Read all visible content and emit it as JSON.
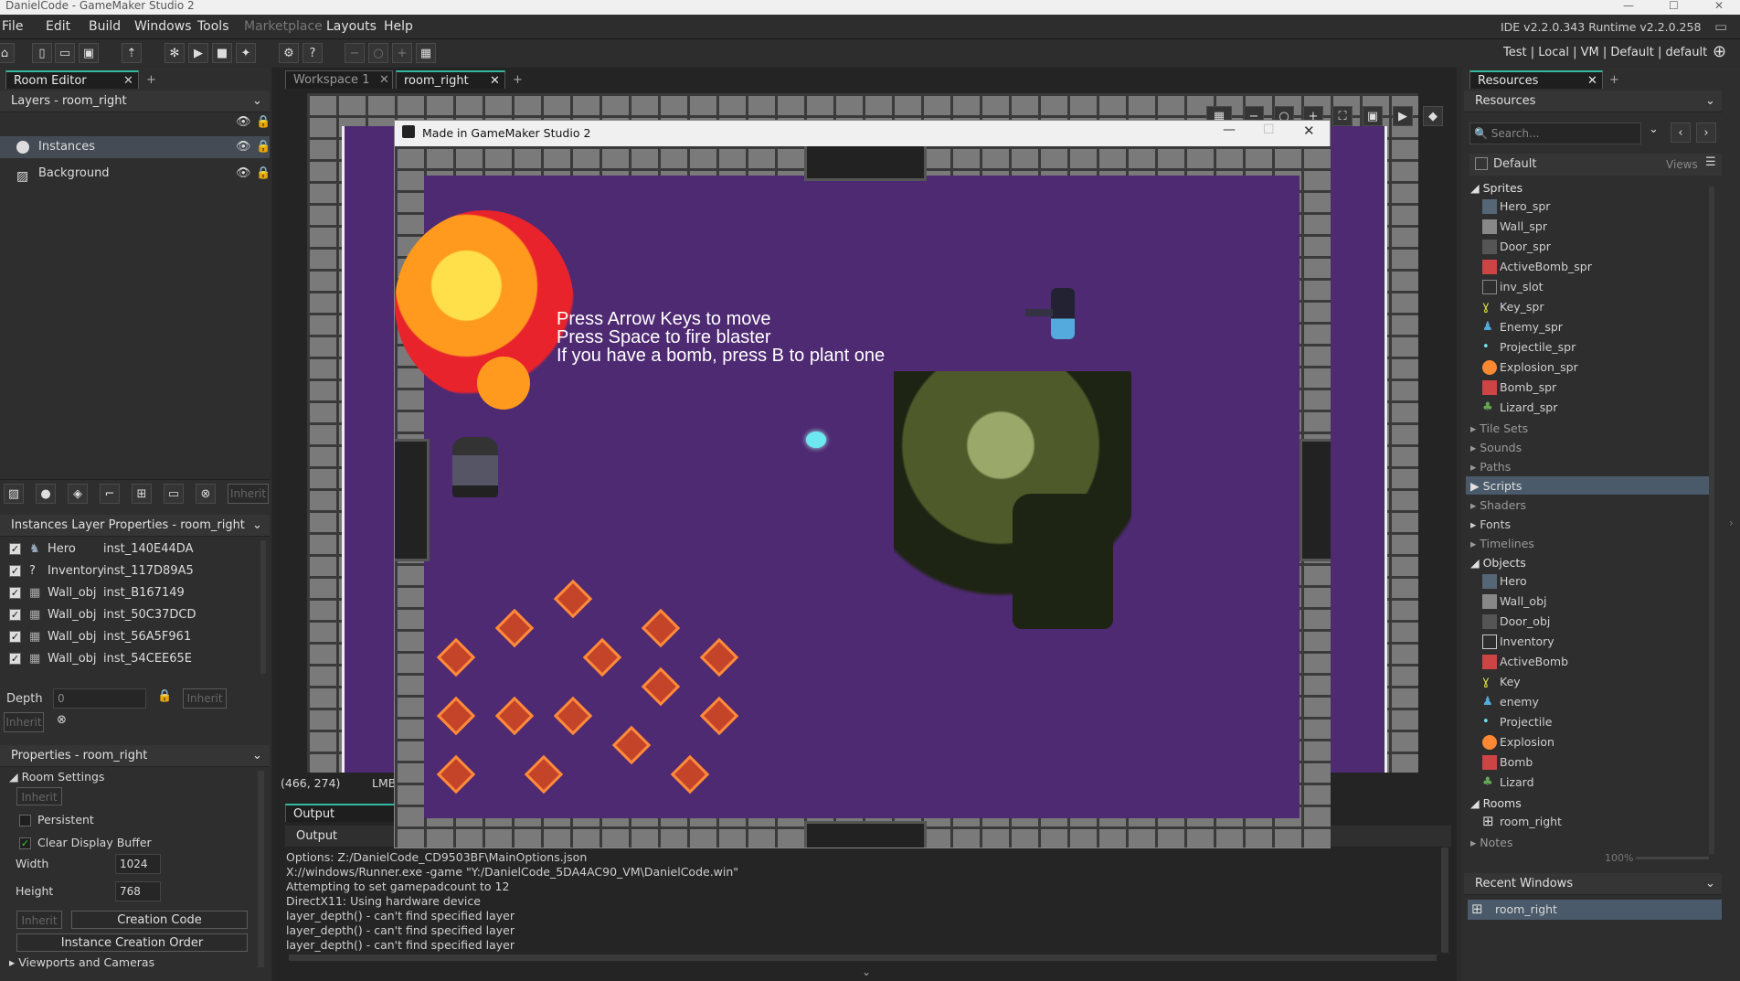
{
  "titlebar": {
    "title": "DanielCode - GameMaker Studio 2",
    "minimize": "—",
    "maximize": "☐",
    "close": "✕"
  },
  "menu": [
    "File",
    "Edit",
    "Build",
    "Windows",
    "Tools",
    "Marketplace",
    "Layouts",
    "Help"
  ],
  "ide_version": "IDE v2.2.0.343 Runtime v2.2.0.258",
  "target_bar": "Test | Local | VM | Default | default",
  "left_panel": {
    "tab": "Room Editor",
    "layers_header": "Layers - room_right",
    "layers": [
      {
        "name": "Instances"
      },
      {
        "name": "Background"
      }
    ],
    "inherit_label": "Inherit",
    "instances_header": "Instances Layer Properties - room_right",
    "instances": [
      {
        "obj": "Hero",
        "id": "inst_140E44DA"
      },
      {
        "obj": "Inventory",
        "id": "inst_117D89A5"
      },
      {
        "obj": "Wall_obj",
        "id": "inst_B167149"
      },
      {
        "obj": "Wall_obj",
        "id": "inst_50C37DCD"
      },
      {
        "obj": "Wall_obj",
        "id": "inst_56A5F961"
      },
      {
        "obj": "Wall_obj",
        "id": "inst_54CEE65E"
      }
    ],
    "depth_label": "Depth",
    "depth_value": "0",
    "properties_header": "Properties - room_right",
    "room_settings": "Room Settings",
    "persistent": "Persistent",
    "clear_display": "Clear Display Buffer",
    "width_label": "Width",
    "width_value": "1024",
    "height_label": "Height",
    "height_value": "768",
    "creation_code": "Creation Code",
    "instance_creation_order": "Instance Creation Order",
    "viewports": "Viewports and Cameras"
  },
  "center": {
    "tabs": [
      "Workspace 1",
      "room_right"
    ],
    "coords": "(466, 274)",
    "mouse": "LMB",
    "output_tab": "Output",
    "output_header": "Output",
    "log": [
      "Options: Z:/DanielCode_CD9503BF\\MainOptions.json",
      "X://windows/Runner.exe  -game \"Y:/DanielCode_5DA4AC90_VM\\DanielCode.win\"",
      "Attempting to set gamepadcount to 12",
      "DirectX11: Using hardware device",
      "layer_depth() - can't find specified layer",
      "layer_depth() - can't find specified layer",
      "layer_depth() - can't find specified layer"
    ]
  },
  "game_window": {
    "title": "Made in GameMaker Studio 2",
    "hint_lines": [
      "Press Arrow Keys to move",
      "Press Space to fire blaster",
      "If you have a bomb, press B to plant one"
    ]
  },
  "right_panel": {
    "tab": "Resources",
    "header": "Resources",
    "search_placeholder": "Search...",
    "group": "Default",
    "views": "Views",
    "sprites_label": "Sprites",
    "sprites": [
      "Hero_spr",
      "Wall_spr",
      "Door_spr",
      "ActiveBomb_spr",
      "inv_slot",
      "Key_spr",
      "Enemy_spr",
      "Projectile_spr",
      "Explosion_spr",
      "Bomb_spr",
      "Lizard_spr"
    ],
    "folders_mid": [
      "Tile Sets",
      "Sounds",
      "Paths",
      "Scripts",
      "Shaders",
      "Fonts",
      "Timelines"
    ],
    "objects_label": "Objects",
    "objects": [
      "Hero",
      "Wall_obj",
      "Door_obj",
      "Inventory",
      "ActiveBomb",
      "Key",
      "enemy",
      "Projectile",
      "Explosion",
      "Bomb",
      "Lizard"
    ],
    "rooms_label": "Rooms",
    "rooms": [
      "room_right"
    ],
    "notes_label": "Notes",
    "zoom": "100%",
    "recent_header": "Recent Windows",
    "recent": [
      "room_right"
    ]
  },
  "colors": {
    "accent": "#35b8a0",
    "game_bg": "#4e2a72",
    "wall": "#7a7a7a",
    "selected": "#4a5a6a"
  }
}
